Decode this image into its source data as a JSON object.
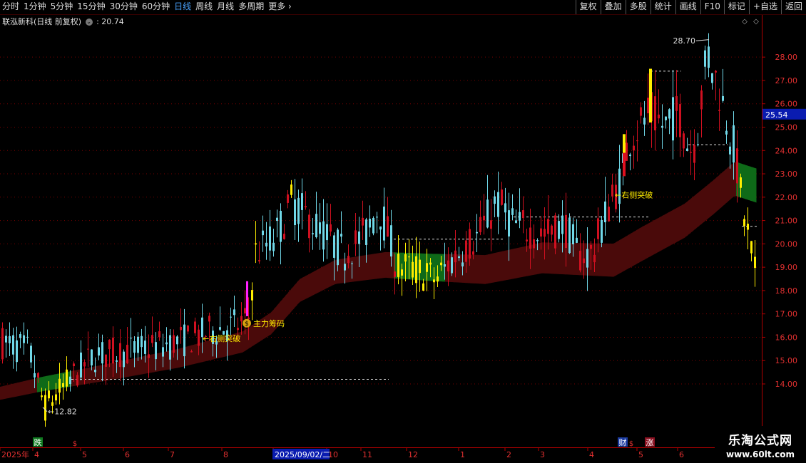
{
  "toolbar": {
    "periods": [
      "分时",
      "1分钟",
      "5分钟",
      "15分钟",
      "30分钟",
      "60分钟",
      "日线",
      "周线",
      "月线",
      "多周期",
      "更多"
    ],
    "selected": "日线",
    "tools": [
      "复权",
      "叠加",
      "多股",
      "统计",
      "画线",
      "F10",
      "标记",
      "+自选",
      "返回"
    ]
  },
  "title": {
    "stock": "联泓新科(日线 前复权)",
    "value": ": 20.74"
  },
  "colors": {
    "up": "#d01020",
    "down": "#70d8e8",
    "signal": "#ffee00",
    "band_up": "#4a0a0a",
    "band_down": "#0e6a18",
    "grid": "#7a0000"
  },
  "chart_data": {
    "type": "candlestick",
    "ylim": [
      12.2,
      29.5
    ],
    "y_ticks": [
      "28.00",
      "27.00",
      "26.00",
      "25.00",
      "24.00",
      "23.00",
      "22.00",
      "21.00",
      "20.00",
      "19.00",
      "18.00",
      "17.00",
      "16.00",
      "15.00",
      "14.00"
    ],
    "current_price_label": "25.54",
    "x_axis_labels": [
      "2025年",
      "4",
      "5",
      "6",
      "7",
      "8",
      "9",
      "10",
      "11",
      "12",
      "1",
      "2",
      "3",
      "4",
      "5",
      "6"
    ],
    "cursor_date": "2025/09/02/二",
    "annotations": {
      "high": "28.70",
      "low": "12.82",
      "breakout_1": "右侧突破",
      "breakout_2": "右侧突破",
      "main_chip": "主力筹码"
    },
    "markers": {
      "fall": "跌",
      "dollar": "$",
      "finance": "财",
      "rise": "涨"
    }
  },
  "watermark": {
    "line1": "乐淘公式网",
    "line2": "www.60lt.com"
  }
}
